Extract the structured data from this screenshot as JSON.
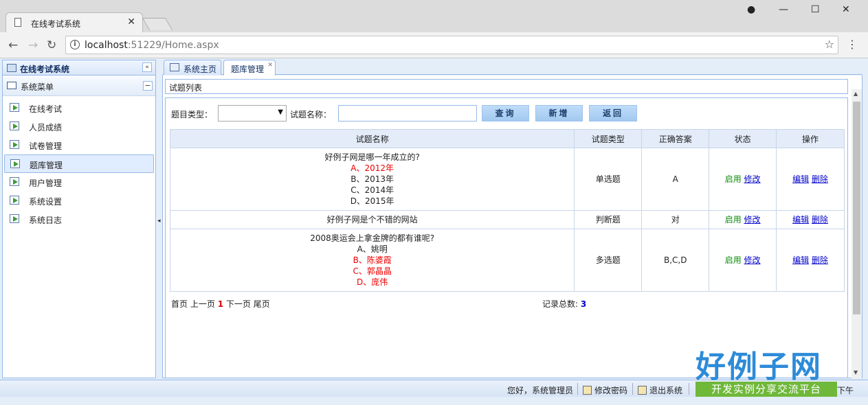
{
  "browser": {
    "tab_title": "在线考试系统",
    "url_host": "localhost",
    "url_rest": ":51229/Home.aspx"
  },
  "sidebar": {
    "title": "在线考试系统",
    "menu_title": "系统菜单",
    "items": [
      {
        "label": "在线考试"
      },
      {
        "label": "人员成绩"
      },
      {
        "label": "试卷管理"
      },
      {
        "label": "题库管理",
        "active": true
      },
      {
        "label": "用户管理"
      },
      {
        "label": "系统设置"
      },
      {
        "label": "系统日志"
      }
    ]
  },
  "tabs": [
    {
      "label": "系统主页"
    },
    {
      "label": "题库管理",
      "active": true
    }
  ],
  "panel": {
    "title": "试题列表"
  },
  "search": {
    "type_label": "题目类型：",
    "type_value": "",
    "name_label": "试题名称：",
    "name_value": "",
    "query_button": "查询",
    "add_button": "新增",
    "back_button": "返回"
  },
  "table": {
    "headers": [
      "试题名称",
      "试题类型",
      "正确答案",
      "状态",
      "操作"
    ],
    "rows": [
      {
        "question": "好例子网是哪一年成立的?",
        "options": [
          {
            "text": "A、2012年",
            "correct": true
          },
          {
            "text": "B、2013年",
            "correct": false
          },
          {
            "text": "C、2014年",
            "correct": false
          },
          {
            "text": "D、2015年",
            "correct": false
          }
        ],
        "type": "单选题",
        "answer": "A",
        "status": "启用",
        "status_link": "修改",
        "edit": "编辑",
        "delete": "删除"
      },
      {
        "question": "好例子网是个不错的网站",
        "options": [],
        "type": "判断题",
        "answer": "对",
        "status": "启用",
        "status_link": "修改",
        "edit": "编辑",
        "delete": "删除"
      },
      {
        "question": "2008奥运会上拿金牌的都有谁呢?",
        "options": [
          {
            "text": "A、姚明",
            "correct": false
          },
          {
            "text": "B、陈婆霞",
            "correct": true
          },
          {
            "text": "C、郭晶晶",
            "correct": true
          },
          {
            "text": "D、庞伟",
            "correct": true
          }
        ],
        "type": "多选题",
        "answer": "B,C,D",
        "status": "启用",
        "status_link": "修改",
        "edit": "编辑",
        "delete": "删除"
      }
    ]
  },
  "pager": {
    "first": "首页",
    "prev": "上一页",
    "current": "1",
    "next": "下一页",
    "last": "尾页",
    "total_label": "记录总数:",
    "total": "3"
  },
  "statusbar": {
    "greeting": "您好，系统管理员",
    "change_password": "修改密码",
    "logout": "退出系统",
    "time_suffix": "下午"
  },
  "watermark": {
    "brand": "好例子网",
    "slogan": "开发实例分享交流平台"
  },
  "colors": {
    "correct_option": "#ee0000",
    "status_enabled": "#0a8a0a",
    "link": "#0000cc",
    "border": "#95b8e7"
  }
}
